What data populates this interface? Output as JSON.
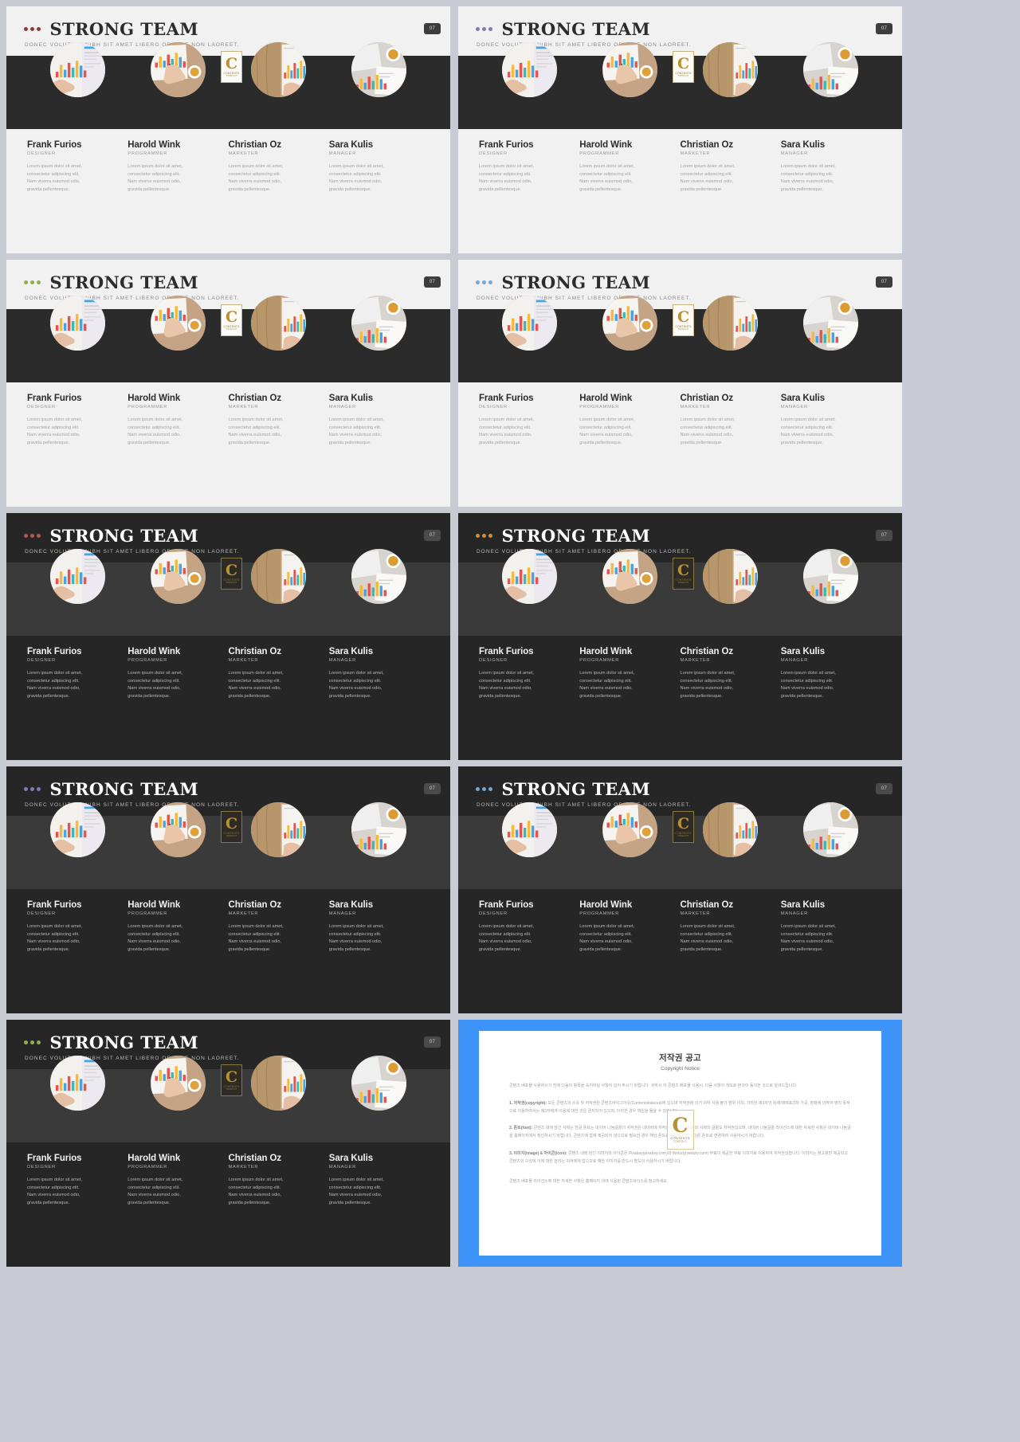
{
  "meta": {
    "page_badge": "07",
    "accent_colors": {
      "maroon": "#8a3b3b",
      "lavender": "#7d7ab5",
      "olive": "#8fae4f",
      "skyblue": "#6fa8dc",
      "orange": "#d98b3c",
      "blue": "#3d93f7"
    }
  },
  "slide": {
    "title": "STRONG TEAM",
    "subtitle": "DONEC VOLUTPAT  NIBH SIT AMET  LIBERO  ORNARE  NON LAOREET."
  },
  "members": [
    {
      "name": "Frank Furios",
      "role": "DESIGNER",
      "desc": "Lorem ipsum dolor sit amet, consectetur adipiscing elit. Nam viverra euismod odio, gravida pellentesque.",
      "photo": "hand-pointing-at-chart-report"
    },
    {
      "name": "Harold Wink",
      "role": "PROGRAMMER",
      "desc": "Lorem ipsum dolor sit amet, consectetur adipiscing elit. Nam viverra euismod odio, gravida pellentesque.",
      "photo": "hand-writing-on-chart-with-coffee"
    },
    {
      "name": "Christian Oz",
      "role": "MARKETER",
      "desc": "Lorem ipsum dolor sit amet, consectetur adipiscing elit. Nam viverra euismod odio, gravida pellentesque.",
      "photo": "chart-paper-on-wooden-desk"
    },
    {
      "name": "Sara Kulis",
      "role": "MANAGER",
      "desc": "Lorem ipsum dolor sit amet, consectetur adipiscing elit. Nam viverra euismod odio, gravida pellentesque.",
      "photo": "charts-and-coffee-cup-top-view"
    }
  ],
  "watermark": {
    "letter": "C",
    "line1": "CONTENTS",
    "line2": "TOKEOUT"
  },
  "slides": [
    {
      "theme": "light",
      "dot_color": "#8a3b3b",
      "band": "#2b2b2b"
    },
    {
      "theme": "light",
      "dot_color": "#7d7ab5",
      "band": "#2b2b2b"
    },
    {
      "theme": "light",
      "dot_color": "#8fae4f",
      "band": "#2b2b2b"
    },
    {
      "theme": "light",
      "dot_color": "#6fa8dc",
      "band": "#2b2b2b"
    },
    {
      "theme": "dark",
      "dot_color": "#b05a50",
      "band": "#3a3a3a"
    },
    {
      "theme": "dark",
      "dot_color": "#d98b3c",
      "band": "#3a3a3a"
    },
    {
      "theme": "dark",
      "dot_color": "#7d7ab5",
      "band": "#3a3a3a"
    },
    {
      "theme": "dark",
      "dot_color": "#6fa8dc",
      "band": "#3a3a3a"
    },
    {
      "theme": "dark",
      "dot_color": "#8fae4f",
      "band": "#3a3a3a"
    }
  ],
  "copyright": {
    "title_ko": "저작권 공고",
    "title_en": "Copyright Notice",
    "lead": "콘텐츠 배포물 사용하시기 전에 다음의 항목을 숙지하실 사항이 있어 주시기 바랍니다. 귀하시 이 콘텐츠 배포물 사용시, 다음 사항이 개또로 본것이 동의한 것으로 알려드립니다.",
    "items": [
      {
        "label": "1. 저작권(copyright):",
        "text": "모든 콘텐츠의 소유 및 저작권은 콘텐츠바이그아웃(Contentstokeout)에 있으며 저작권에 의거 귀하 사용 불가 범위 이외, 기타한 제3자의 복제/재배포/2차 가공, 판매에 의하여 영리 목적으로 이용하여서는 제3자에게 이용에 대한 것은 금지되어 있으며, 이러한 경우 책임을 물을 수 있습니다."
      },
      {
        "label": "2. 폰트(font):",
        "text": "콘텐츠 내에 담긴 서체는 한글 폰트는 네이버 나눔글꼴의 저작권은 네이버에 저작권있습니다. 한글 외 서체의 글꼴도 저작권있으며, 네이버 나눔글꼴 라이선스에 대한 자세한 사항은 네이버 나눔글꼴 홈페이지에서 확인하시기 바랍니다. 콘텐츠에 함께 제공되지 않으므로 필요한 경우 해당 폰트를 구입하시거나 다른 폰트로 변경하여 사용하시기 바랍니다."
      },
      {
        "label": "3. 이미지(image) & 아이콘(icon):",
        "text": "콘텐츠 내에 담긴 이미지와 아이콘은 Pixabay(pixabay.com)와 Webzly(webzly.com) 무료이 제공한 무료 이미지로 이용하여 저작권있습니다. 이미지는 참고용만 제공되고 콘텐츠의 구성에 이에 대한 권리는 귀하에게 없으므로 해당 이미지를 반드시 별도이 사용하시기 바랍니다."
      }
    ],
    "footer": "콘텐츠 배포물 라이선스에 대한 자세한 사항은 홈페이지 내에 사용된 콘텐츠바이스를 참고하세요.",
    "watermark": {
      "letter": "C",
      "line1": "CONTENTS",
      "line2": "TOKEOUT"
    }
  }
}
